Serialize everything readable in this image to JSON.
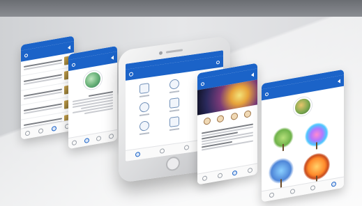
{
  "scene": {
    "background_colors": {
      "top": "#6a6d72",
      "floor": "#e3e4e6",
      "accent": "#1b63c8"
    }
  },
  "screens": [
    {
      "id": "list",
      "icon_names": [
        "back-icon",
        "search-icon"
      ]
    },
    {
      "id": "profile",
      "icon_names": [
        "avatar"
      ]
    },
    {
      "id": "home-grid",
      "icon_names": [
        "menu-icon",
        "grid-icons"
      ]
    },
    {
      "id": "book-detail",
      "icon_names": [
        "cover-image",
        "book-icons"
      ]
    },
    {
      "id": "trees-gallery",
      "icon_names": [
        "avatar",
        "tree-images"
      ]
    }
  ]
}
